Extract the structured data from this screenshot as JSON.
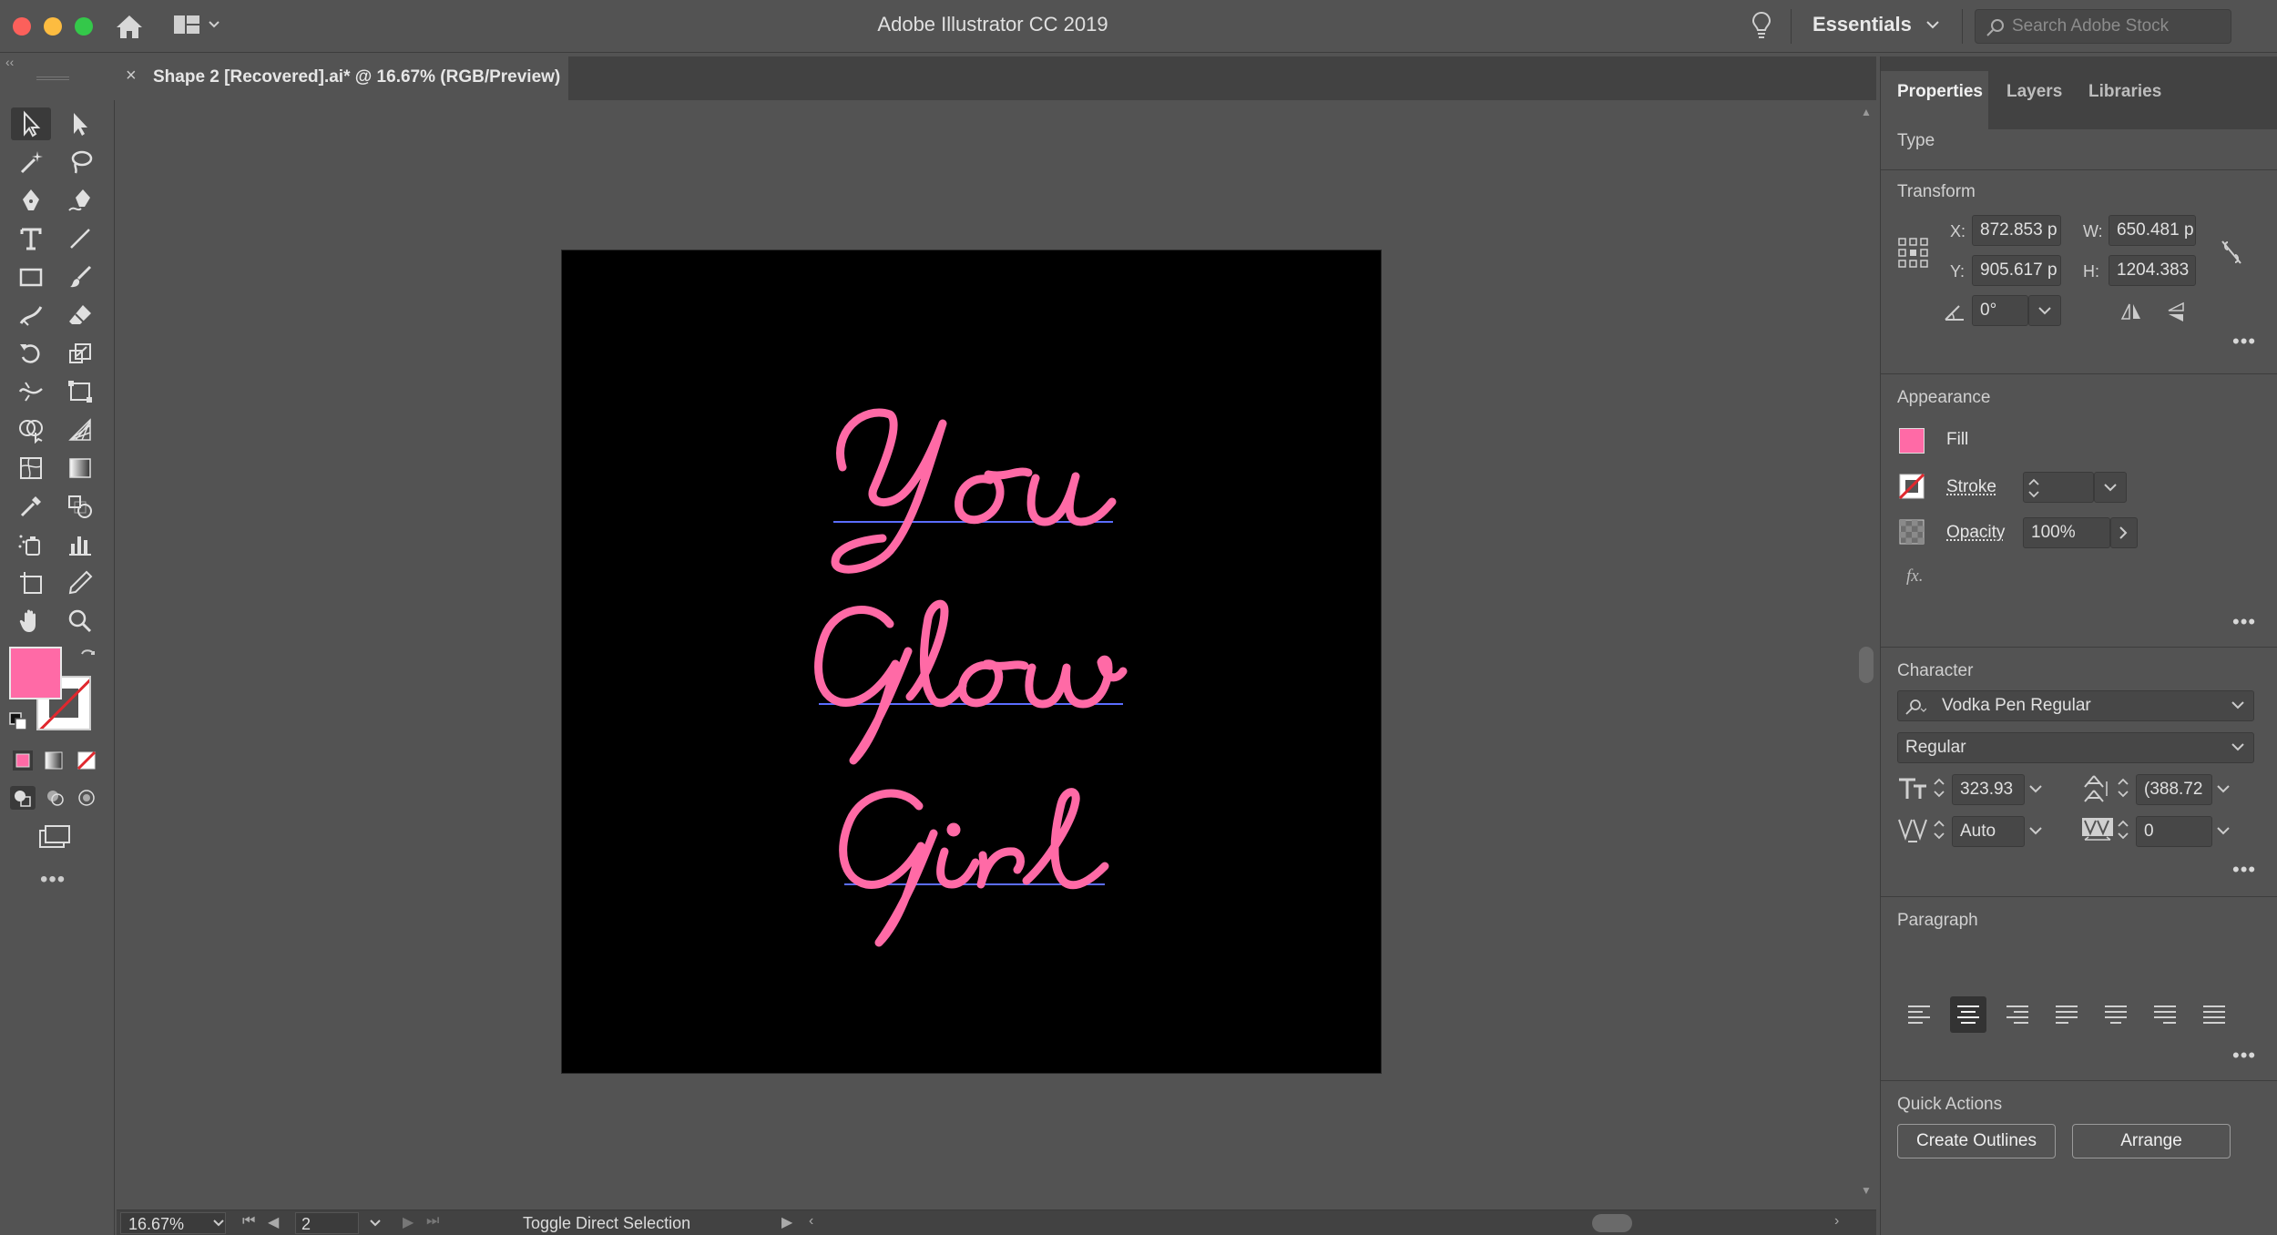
{
  "titlebar": {
    "app_title": "Adobe Illustrator CC 2019",
    "workspace": "Essentials",
    "search_placeholder": "Search Adobe Stock"
  },
  "document": {
    "tab_label": "Shape 2 [Recovered].ai* @ 16.67% (RGB/Preview)",
    "close_glyph": "×"
  },
  "artwork": {
    "lines": [
      "You",
      "Glow",
      "Girl"
    ],
    "text_color": "#ff6aa6",
    "baseline_color": "#5b6dff",
    "background": "#000000"
  },
  "toolbar": {
    "tools": [
      "selection",
      "direct-selection",
      "magic-wand",
      "lasso",
      "pen",
      "curvature",
      "type",
      "line-segment",
      "rectangle",
      "paintbrush",
      "shaper",
      "eraser",
      "rotate",
      "scale",
      "warp",
      "free-transform",
      "shape-builder",
      "perspective-grid",
      "mesh",
      "gradient",
      "eyedropper",
      "blend",
      "symbol-sprayer",
      "column-graph",
      "artboard",
      "slice",
      "hand",
      "zoom"
    ],
    "fill_color": "#ff6aa6",
    "more": "•••"
  },
  "statusbar": {
    "zoom": "16.67%",
    "page": "2",
    "status_text": "Toggle Direct Selection"
  },
  "panel": {
    "tabs": [
      "Properties",
      "Layers",
      "Libraries"
    ],
    "type_title": "Type",
    "transform": {
      "title": "Transform",
      "x_label": "X:",
      "x": "872.853 p",
      "y_label": "Y:",
      "y": "905.617 p",
      "w_label": "W:",
      "w": "650.481 p",
      "h_label": "H:",
      "h": "1204.383",
      "angle": "0°"
    },
    "appearance": {
      "title": "Appearance",
      "fill_label": "Fill",
      "stroke_label": "Stroke",
      "opacity_label": "Opacity",
      "opacity": "100%",
      "fx": "fx."
    },
    "character": {
      "title": "Character",
      "font": "Vodka Pen Regular",
      "style": "Regular",
      "size": "323.93",
      "leading": "(388.72",
      "kerning": "Auto",
      "tracking": "0"
    },
    "paragraph": {
      "title": "Paragraph"
    },
    "quick_actions": {
      "title": "Quick Actions",
      "create_outlines": "Create Outlines",
      "arrange": "Arrange"
    },
    "more": "•••"
  }
}
